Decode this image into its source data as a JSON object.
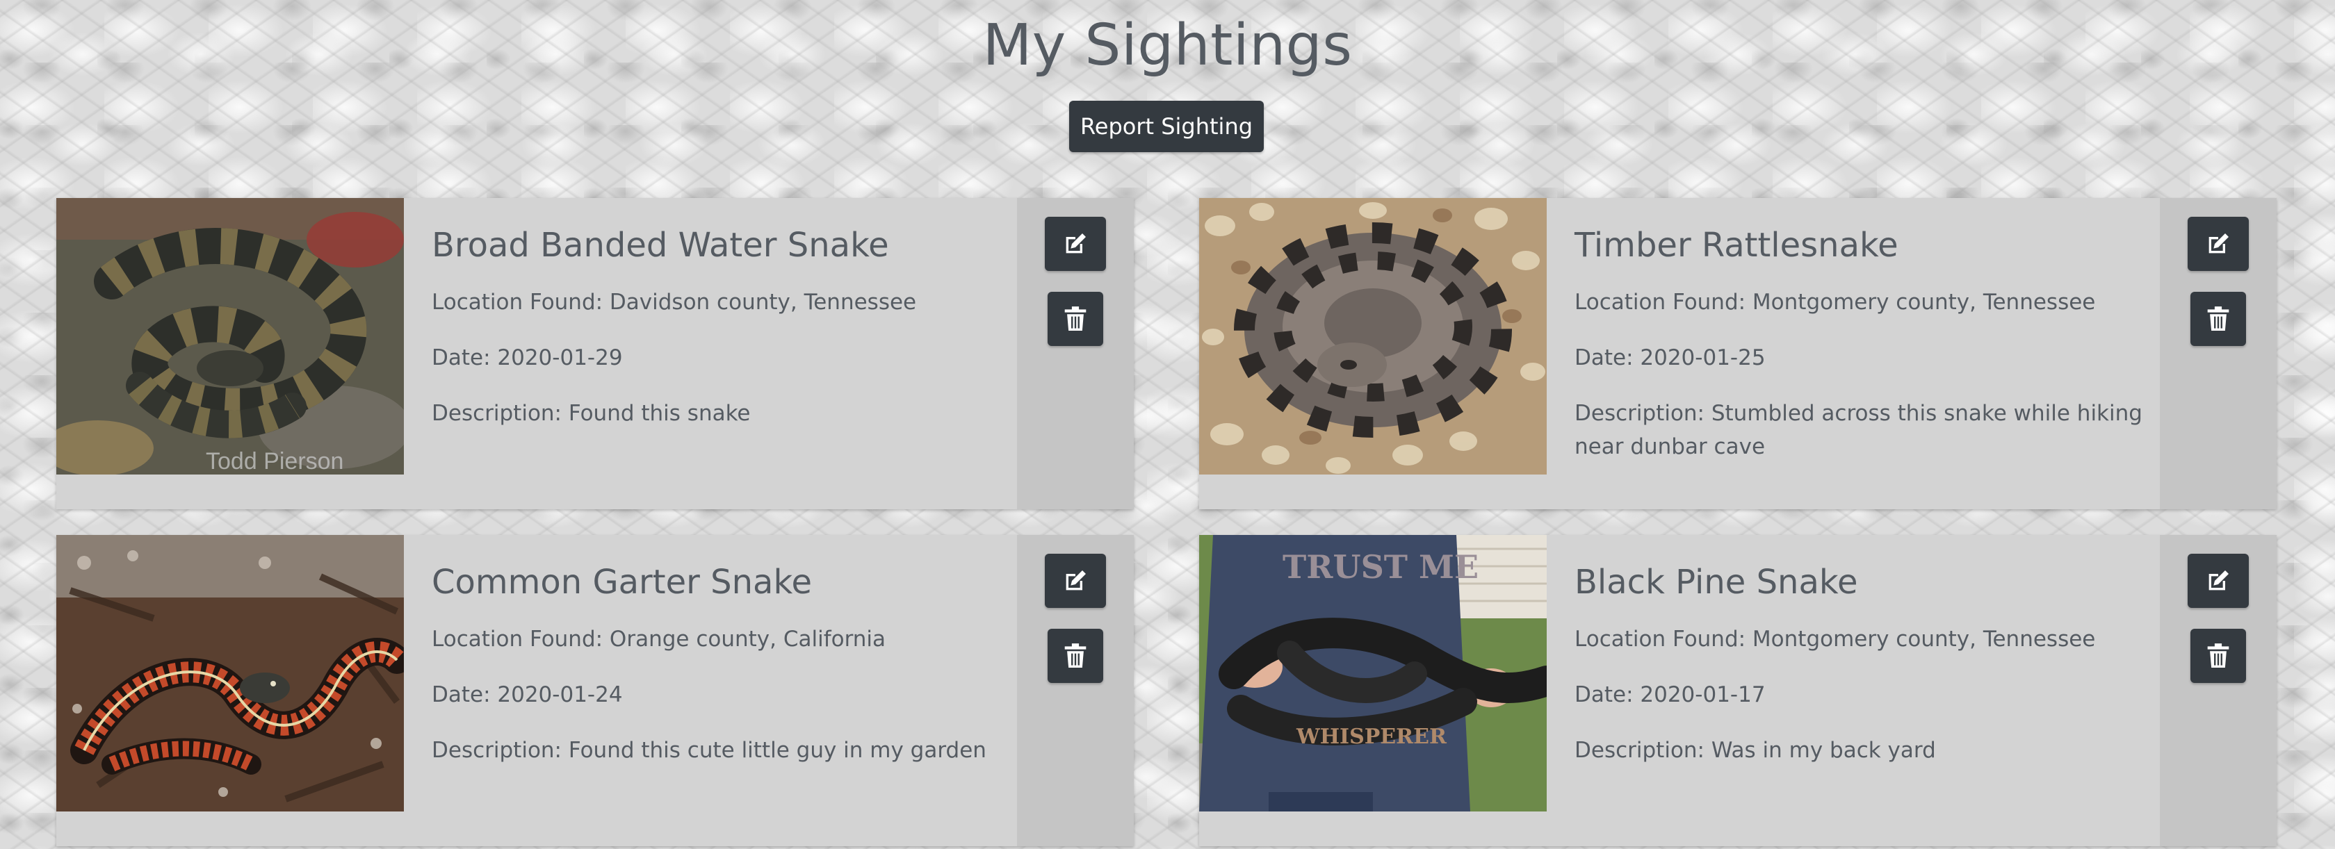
{
  "page": {
    "title": "My Sightings",
    "report_button_label": "Report Sighting"
  },
  "sightings": [
    {
      "name": "Broad Banded Water Snake",
      "location": "Location Found: Davidson county, Tennessee",
      "date": "Date: 2020-01-29",
      "description": "Description: Found this snake",
      "photo_watermark": "Todd Pierson"
    },
    {
      "name": "Timber Rattlesnake",
      "location": "Location Found: Montgomery county, Tennessee",
      "date": "Date: 2020-01-25",
      "description": "Description: Stumbled across this snake while hiking near dunbar cave"
    },
    {
      "name": "Common Garter Snake",
      "location": "Location Found: Orange county, California",
      "date": "Date: 2020-01-24",
      "description": "Description: Found this cute little guy in my garden"
    },
    {
      "name": "Black Pine Snake",
      "location": "Location Found: Montgomery county, Tennessee",
      "date": "Date: 2020-01-17",
      "description": "Description: Was in my back yard",
      "photo_shirt_text": [
        "TRUST ME",
        "WHISPERER"
      ]
    }
  ],
  "icons": {
    "edit": "edit-icon",
    "delete": "trash-icon"
  },
  "colors": {
    "button_dark": "#343a40",
    "card_background": "#d3d3d3",
    "card_sidebar": "#c5c5c5",
    "text": "#555b62"
  }
}
